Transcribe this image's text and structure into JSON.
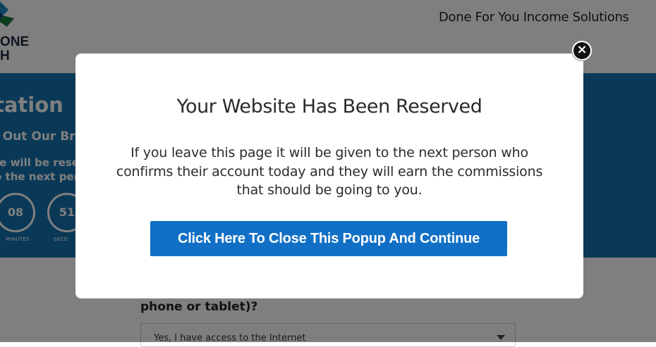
{
  "header": {
    "logo_text": "ONE\nH",
    "tagline": "Done For You Income Solutions"
  },
  "hero": {
    "title": "tation",
    "subtitle": "l Out Our Bri",
    "note_line1": "te will be reser",
    "note_line2": "o the next perso",
    "timers": [
      {
        "value": "08",
        "label": "MINUTES"
      },
      {
        "value": "51",
        "label": "SECO"
      }
    ]
  },
  "form": {
    "question": "phone or tablet)?",
    "select_value": "Yes, I have access to the Internet"
  },
  "modal": {
    "title": "Your Website Has Been Reserved",
    "body": "If you leave this page it will be given to the next person who confirms their account today and they will earn the commissions that should be going to you.",
    "cta_label": "Click Here To Close This Popup And Continue",
    "close_glyph": "×"
  },
  "colors": {
    "hero_blue": "#1573ae",
    "cta_blue": "#1170c6",
    "overlay": "rgba(0,0,0,0.5)"
  }
}
